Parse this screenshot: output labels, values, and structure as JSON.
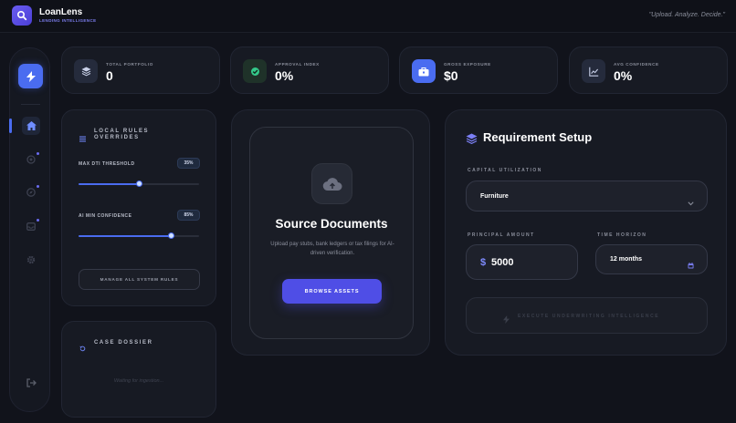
{
  "brand": {
    "name": "LoanLens",
    "subtitle": "LENDING INTELLIGENCE",
    "tagline": "\"Upload. Analyze. Decide.\""
  },
  "sidebar": {
    "items": [
      {
        "icon": "bolt-icon"
      },
      {
        "icon": "home-icon",
        "active": true
      },
      {
        "icon": "target-icon"
      },
      {
        "icon": "compass-icon"
      },
      {
        "icon": "inbox-icon"
      },
      {
        "icon": "gear-icon"
      },
      {
        "icon": "logout-icon"
      }
    ]
  },
  "stats": [
    {
      "label": "TOTAL PORTFOLIO",
      "value": "0",
      "icon": "layers-icon"
    },
    {
      "label": "APPROVAL INDEX",
      "value": "0%",
      "icon": "check-circle-icon"
    },
    {
      "label": "GROSS EXPOSURE",
      "value": "$0",
      "icon": "briefcase-icon"
    },
    {
      "label": "AVG CONFIDENCE",
      "value": "0%",
      "icon": "trend-icon"
    }
  ],
  "rules": {
    "title_line1": "LOCAL RULES",
    "title_line2": "OVERRIDES",
    "sliders": [
      {
        "label": "MAX DTI THRESHOLD",
        "value": "35%",
        "fraction": 0.5
      },
      {
        "label": "AI MIN CONFIDENCE",
        "value": "85%",
        "fraction": 0.76
      }
    ],
    "manage_label": "MANAGE ALL SYSTEM RULES"
  },
  "dossier": {
    "title": "CASE DOSSIER",
    "placeholder": "Waiting for ingestion..."
  },
  "upload": {
    "title": "Source Documents",
    "description": "Upload pay stubs, bank ledgers or tax filings for AI-driven verification.",
    "button_label": "BROWSE ASSETS"
  },
  "requirement": {
    "title": "Requirement Setup",
    "capital_label": "CAPITAL UTILIZATION",
    "capital_value": "Furniture",
    "principal_label": "PRINCIPAL AMOUNT",
    "currency": "$",
    "principal_value": "5000",
    "horizon_label": "TIME HORIZON",
    "horizon_value": "12 months",
    "execute_label": "EXECUTE UNDERWRITING INTELLIGENCE"
  },
  "colors": {
    "accent": "#4a6cf0",
    "primary_button": "#4f4ee6",
    "background": "#11131b",
    "success": "#34c98a"
  }
}
